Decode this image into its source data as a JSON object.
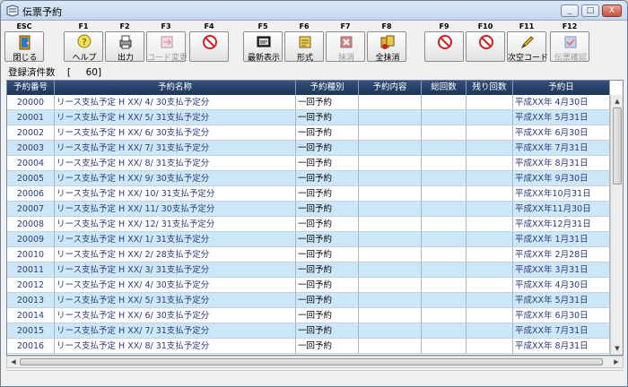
{
  "window": {
    "title": "伝票予約",
    "minimize": "_",
    "maximize": "□",
    "close": "X"
  },
  "toolbar": [
    {
      "key": "ESC",
      "label": "閉じる",
      "icon": "door-icon",
      "enabled": true
    },
    {
      "key": "F1",
      "label": "ヘルプ",
      "icon": "help-icon",
      "enabled": true
    },
    {
      "key": "F2",
      "label": "出力",
      "icon": "printer-icon",
      "enabled": true
    },
    {
      "key": "F3",
      "label": "コード変更",
      "icon": "code-change-icon",
      "enabled": false
    },
    {
      "key": "F4",
      "label": "",
      "icon": "prohibited-icon",
      "enabled": true
    },
    {
      "key": "F5",
      "label": "最新表示",
      "icon": "refresh-display-icon",
      "enabled": true
    },
    {
      "key": "F6",
      "label": "形式",
      "icon": "format-icon",
      "enabled": true
    },
    {
      "key": "F7",
      "label": "抹消",
      "icon": "delete-icon",
      "enabled": false
    },
    {
      "key": "F8",
      "label": "全抹消",
      "icon": "delete-all-icon",
      "enabled": true
    },
    {
      "key": "F9",
      "label": "",
      "icon": "prohibited-icon",
      "enabled": true
    },
    {
      "key": "F10",
      "label": "",
      "icon": "prohibited-icon",
      "enabled": true
    },
    {
      "key": "F11",
      "label": "次空コード",
      "icon": "pencil-icon",
      "enabled": true
    },
    {
      "key": "F12",
      "label": "伝票確認",
      "icon": "voucher-check-icon",
      "enabled": false
    }
  ],
  "summary": {
    "label": "登録済件数",
    "value": "[     60]"
  },
  "grid": {
    "columns": [
      "予約番号",
      "予約名称",
      "予約種別",
      "予約内容",
      "総回数",
      "残り回数",
      "予約日"
    ],
    "rows": [
      {
        "id": "20000",
        "name": "リース支払予定 H XX/ 4/ 30支払予定分",
        "type": "一回予約",
        "content": "",
        "total": "",
        "remaining": "",
        "date": "平成XX年 4月30日"
      },
      {
        "id": "20001",
        "name": "リース支払予定 H XX/ 5/ 31支払予定分",
        "type": "一回予約",
        "content": "",
        "total": "",
        "remaining": "",
        "date": "平成XX年 5月31日"
      },
      {
        "id": "20002",
        "name": "リース支払予定 H XX/ 6/ 30支払予定分",
        "type": "一回予約",
        "content": "",
        "total": "",
        "remaining": "",
        "date": "平成XX年 6月30日"
      },
      {
        "id": "20003",
        "name": "リース支払予定 H XX/ 7/ 31支払予定分",
        "type": "一回予約",
        "content": "",
        "total": "",
        "remaining": "",
        "date": "平成XX年 7月31日"
      },
      {
        "id": "20004",
        "name": "リース支払予定 H XX/ 8/ 31支払予定分",
        "type": "一回予約",
        "content": "",
        "total": "",
        "remaining": "",
        "date": "平成XX年 8月31日"
      },
      {
        "id": "20005",
        "name": "リース支払予定 H XX/ 9/ 30支払予定分",
        "type": "一回予約",
        "content": "",
        "total": "",
        "remaining": "",
        "date": "平成XX年 9月30日"
      },
      {
        "id": "20006",
        "name": "リース支払予定 H XX/ 10/ 31支払予定分",
        "type": "一回予約",
        "content": "",
        "total": "",
        "remaining": "",
        "date": "平成XX年10月31日"
      },
      {
        "id": "20007",
        "name": "リース支払予定 H XX/ 11/ 30支払予定分",
        "type": "一回予約",
        "content": "",
        "total": "",
        "remaining": "",
        "date": "平成XX年11月30日"
      },
      {
        "id": "20008",
        "name": "リース支払予定 H XX/ 12/ 31支払予定分",
        "type": "一回予約",
        "content": "",
        "total": "",
        "remaining": "",
        "date": "平成XX年12月31日"
      },
      {
        "id": "20009",
        "name": "リース支払予定 H XX/ 1/ 31支払予定分",
        "type": "一回予約",
        "content": "",
        "total": "",
        "remaining": "",
        "date": "平成XX年 1月31日"
      },
      {
        "id": "20010",
        "name": "リース支払予定 H XX/ 2/ 28支払予定分",
        "type": "一回予約",
        "content": "",
        "total": "",
        "remaining": "",
        "date": "平成XX年 2月28日"
      },
      {
        "id": "20011",
        "name": "リース支払予定 H XX/ 3/ 31支払予定分",
        "type": "一回予約",
        "content": "",
        "total": "",
        "remaining": "",
        "date": "平成XX年 3月31日"
      },
      {
        "id": "20012",
        "name": "リース支払予定 H XX/ 4/ 30支払予定分",
        "type": "一回予約",
        "content": "",
        "total": "",
        "remaining": "",
        "date": "平成XX年 4月30日"
      },
      {
        "id": "20013",
        "name": "リース支払予定 H XX/ 5/ 31支払予定分",
        "type": "一回予約",
        "content": "",
        "total": "",
        "remaining": "",
        "date": "平成XX年 5月31日"
      },
      {
        "id": "20014",
        "name": "リース支払予定 H XX/ 6/ 30支払予定分",
        "type": "一回予約",
        "content": "",
        "total": "",
        "remaining": "",
        "date": "平成XX年 6月30日"
      },
      {
        "id": "20015",
        "name": "リース支払予定 H XX/ 7/ 31支払予定分",
        "type": "一回予約",
        "content": "",
        "total": "",
        "remaining": "",
        "date": "平成XX年 7月31日"
      },
      {
        "id": "20016",
        "name": "リース支払予定 H XX/ 8/ 31支払予定分",
        "type": "一回予約",
        "content": "",
        "total": "",
        "remaining": "",
        "date": "平成XX年 8月31日"
      }
    ]
  },
  "scroll": {
    "up": "▲",
    "down": "▼",
    "left": "◀",
    "right": "▶"
  },
  "colors": {
    "header": "#1d3557",
    "row_alt": "#cce8f8",
    "text": "#2d3a7a"
  }
}
